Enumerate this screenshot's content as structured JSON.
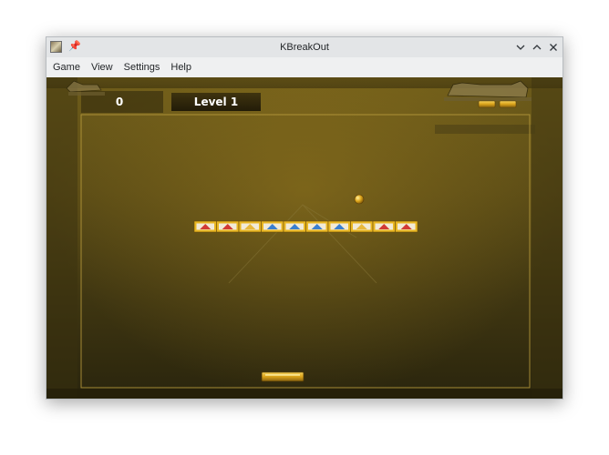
{
  "window": {
    "title": "KBreakOut"
  },
  "menubar": {
    "items": [
      "Game",
      "View",
      "Settings",
      "Help"
    ]
  },
  "titlebar_icons": [
    "app-icon",
    "pin-icon",
    "minimize-icon",
    "maximize-icon",
    "close-icon"
  ],
  "game": {
    "score": "0",
    "level": "Level 1",
    "lives_remaining": 2,
    "brick_colors": [
      "red",
      "red",
      "yellow",
      "blue",
      "blue",
      "blue",
      "blue",
      "yellow",
      "red",
      "red"
    ],
    "palette": {
      "red": "#d23a35",
      "yellow": "#e8b93c",
      "blue": "#3a7fd0",
      "gold": "#e9b722",
      "background": "#5b4c16"
    }
  }
}
